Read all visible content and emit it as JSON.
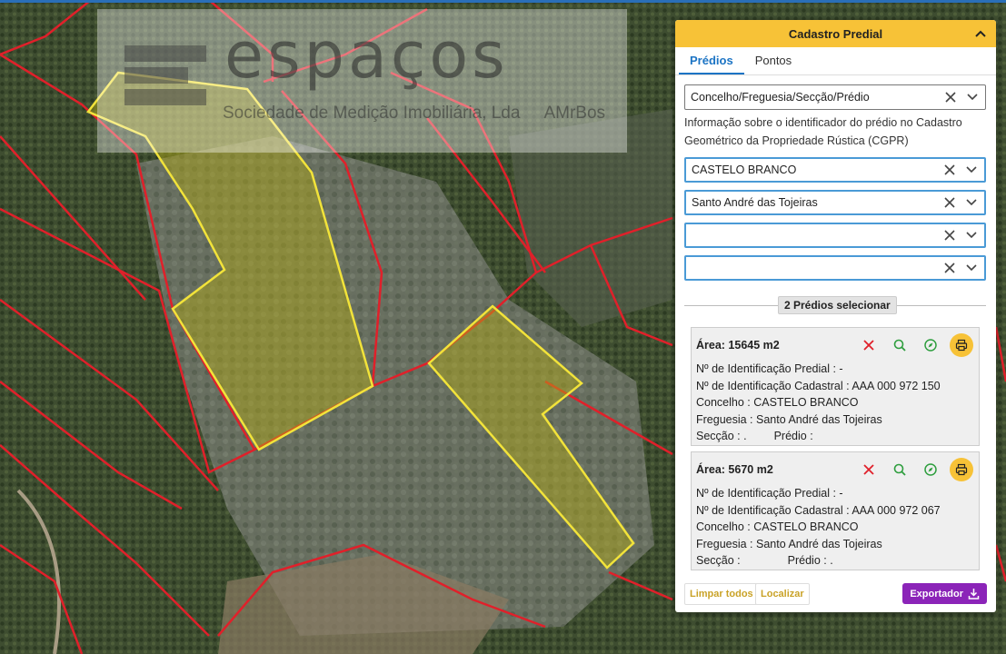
{
  "map": {
    "logo": {
      "word": "espaços",
      "subtitle": "Sociedade de Medição Imobiliária, Lda",
      "place": "AMrBos"
    }
  },
  "panel": {
    "title": "Cadastro Predial",
    "tabs": [
      {
        "label": "Prédios",
        "active": true
      },
      {
        "label": "Pontos",
        "active": false
      }
    ],
    "search_mode": "Concelho/Freguesia/Secção/Prédio",
    "info_text": "Informação sobre o identificador do prédio no Cadastro Geométrico da Propriedade Rústica (CGPR)",
    "fields": [
      "CASTELO BRANCO",
      "Santo André das Tojeiras",
      "",
      ""
    ],
    "count_label": "2 Prédios selecionar",
    "cards": [
      {
        "area": "Área: 15645 m2",
        "id_predial": "Nº de Identificação Predial : -",
        "id_cadastral": "Nº de Identificação Cadastral : AAA 000 972 150",
        "concelho": "Concelho : CASTELO BRANCO",
        "freguesia": "Freguesia : Santo André das Tojeiras",
        "seccao": "Secção : .",
        "predio": "Prédio :"
      },
      {
        "area": "Área: 5670 m2",
        "id_predial": "Nº de Identificação Predial : -",
        "id_cadastral": "Nº de Identificação Cadastral : AAA 000 972 067",
        "concelho": "Concelho : CASTELO BRANCO",
        "freguesia": "Freguesia : Santo André das Tojeiras",
        "seccao": "Secção :",
        "predio": "Prédio : ."
      }
    ],
    "footer": {
      "clear_all": "Limpar todos",
      "locate": "Localizar",
      "export": "Exportador"
    }
  },
  "colors": {
    "accent_yellow": "#f7c237",
    "tab_blue": "#1c74c4",
    "export_purple": "#8b24b8",
    "parcel_outline": "#e0202a",
    "selected_outline": "#f2e33a"
  }
}
